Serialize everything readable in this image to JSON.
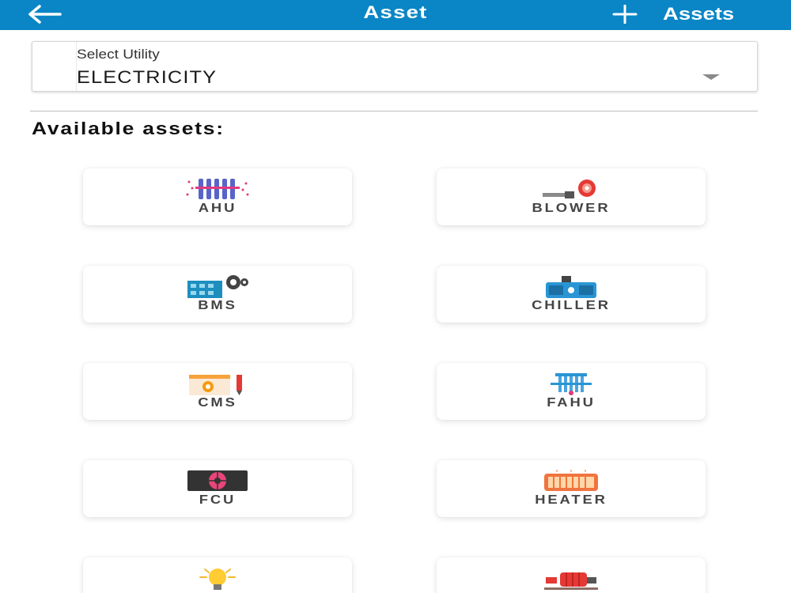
{
  "header": {
    "title": "Asset",
    "add_label": "Assets",
    "background": "#0a86c6"
  },
  "utility_select": {
    "label": "Select Utility",
    "value": "ELECTRICITY"
  },
  "section_title": "Available assets:",
  "assets": [
    {
      "label": "AHU",
      "icon": "ahu-icon"
    },
    {
      "label": "BLOWER",
      "icon": "blower-icon"
    },
    {
      "label": "BMS",
      "icon": "bms-icon"
    },
    {
      "label": "CHILLER",
      "icon": "chiller-icon"
    },
    {
      "label": "CMS",
      "icon": "cms-icon"
    },
    {
      "label": "FAHU",
      "icon": "fahu-icon"
    },
    {
      "label": "FCU",
      "icon": "fcu-icon"
    },
    {
      "label": "HEATER",
      "icon": "heater-icon"
    },
    {
      "label": "",
      "icon": "light-bulb-icon"
    },
    {
      "label": "",
      "icon": "pump-icon"
    }
  ]
}
